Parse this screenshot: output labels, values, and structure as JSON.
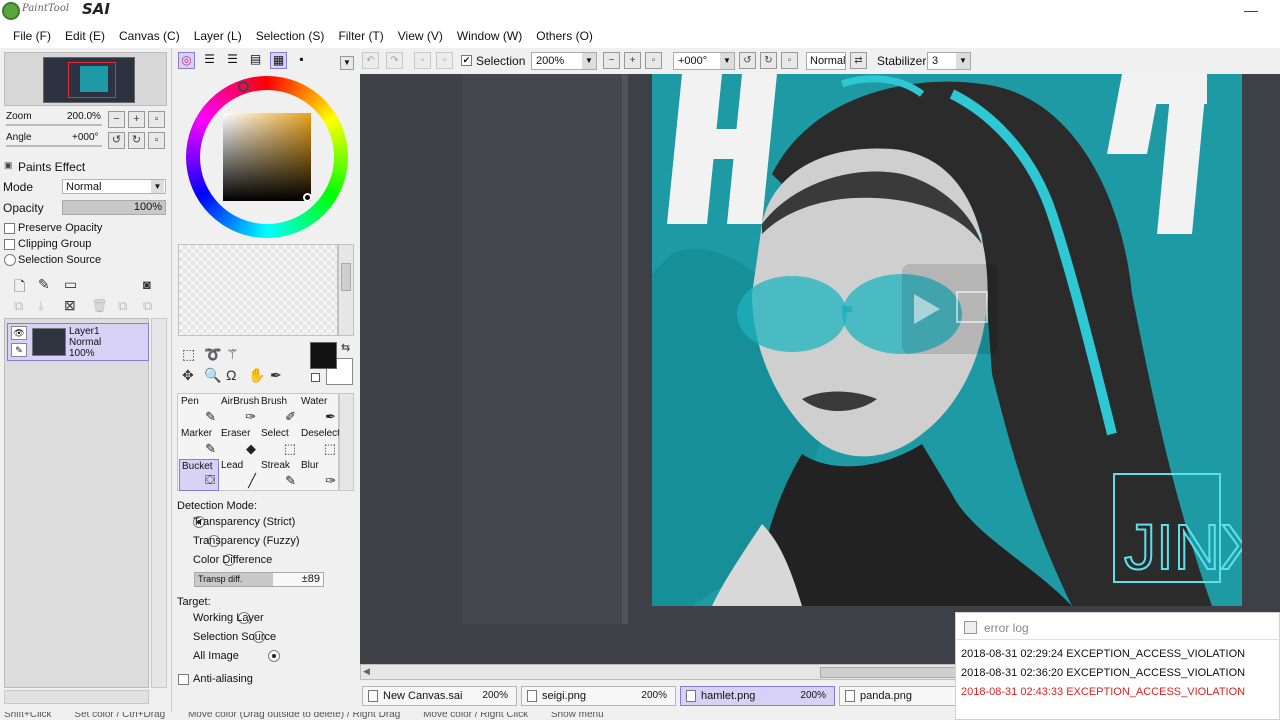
{
  "app": {
    "title_small": "PaintTool",
    "title_big": "SAI",
    "minimize": "—"
  },
  "menu": [
    "File (F)",
    "Edit (E)",
    "Canvas (C)",
    "Layer (L)",
    "Selection (S)",
    "Filter (T)",
    "View (V)",
    "Window (W)",
    "Others (O)"
  ],
  "navigator": {
    "zoom_label": "Zoom",
    "zoom_value": "200.0%",
    "angle_label": "Angle",
    "angle_value": "+000°"
  },
  "layer_props": {
    "paints_effect": "Paints Effect",
    "mode_label": "Mode",
    "mode_value": "Normal",
    "opacity_label": "Opacity",
    "opacity_value": "100%",
    "preserve_opacity": "Preserve Opacity",
    "clipping_group": "Clipping Group",
    "selection_source": "Selection Source"
  },
  "layers": [
    {
      "name": "Layer1",
      "mode": "Normal",
      "opacity": "100%"
    }
  ],
  "colors": {
    "foreground": "#111111",
    "background": "#ffffff",
    "accent_selected": "#d7d2f5",
    "artwork_teal": "#1e9aa4",
    "error_red": "#e02020"
  },
  "tools": [
    {
      "name": "Pen",
      "icon": "pen-icon"
    },
    {
      "name": "AirBrush",
      "icon": "airbrush-icon"
    },
    {
      "name": "Brush",
      "icon": "brush-icon"
    },
    {
      "name": "Water",
      "icon": "water-icon"
    },
    {
      "name": "Marker",
      "icon": "marker-icon"
    },
    {
      "name": "Eraser",
      "icon": "eraser-icon"
    },
    {
      "name": "Select",
      "icon": "select-icon"
    },
    {
      "name": "Deselect",
      "icon": "deselect-icon"
    },
    {
      "name": "Bucket",
      "icon": "bucket-icon",
      "active": true
    },
    {
      "name": "Lead",
      "icon": "lead-icon"
    },
    {
      "name": "Streak",
      "icon": "streak-icon"
    },
    {
      "name": "Blur",
      "icon": "blur-icon"
    }
  ],
  "tool_options": {
    "detection_mode_label": "Detection Mode:",
    "detection_modes": [
      "Transparency (Strict)",
      "Transparency (Fuzzy)",
      "Color Difference"
    ],
    "detection_selected": 0,
    "transp_label": "Transp diff.",
    "transp_value": "±89",
    "target_label": "Target:",
    "targets": [
      "Working Layer",
      "Selection Source",
      "All Image"
    ],
    "target_selected": 2,
    "anti_aliasing": "Anti-aliasing"
  },
  "toolbar": {
    "selection_label": "Selection",
    "selection_checked": true,
    "zoom_value": "200%",
    "angle_value": "+000°",
    "blend_value": "Normal",
    "stabilizer_label": "Stabilizer",
    "stabilizer_value": "3"
  },
  "artwork": {
    "title_letters": "HAMLET",
    "signature": "JINX"
  },
  "doc_tabs": [
    {
      "name": "New Canvas.sai",
      "zoom": "200%",
      "active": false
    },
    {
      "name": "seigi.png",
      "zoom": "200%",
      "active": false
    },
    {
      "name": "hamlet.png",
      "zoom": "200%",
      "active": true
    },
    {
      "name": "panda.png",
      "zoom": "",
      "active": false
    }
  ],
  "error_log": {
    "title": "error log",
    "entries": [
      {
        "text": "2018-08-31 02:29:24 EXCEPTION_ACCESS_VIOLATION",
        "highlight": false
      },
      {
        "text": "2018-08-31 02:36:20 EXCEPTION_ACCESS_VIOLATION",
        "highlight": false
      },
      {
        "text": "2018-08-31 02:43:33 EXCEPTION_ACCESS_VIOLATION",
        "highlight": true
      }
    ]
  },
  "statusbar": {
    "hints": [
      "Shift+Click",
      "Set color / Ctrl+Drag",
      "Move color (Drag outside to delete) / Right Drag",
      "Move color / Right Click",
      "Show menu"
    ]
  }
}
